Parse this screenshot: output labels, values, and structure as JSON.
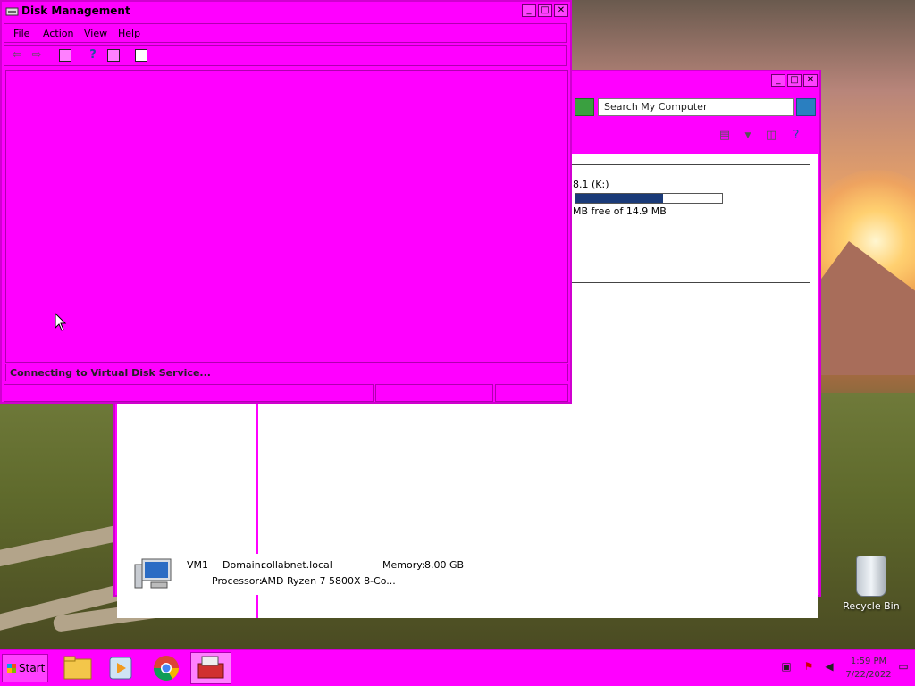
{
  "diskmgmt": {
    "title": "Disk Management",
    "menu": [
      "File",
      "Action",
      "View",
      "Help"
    ],
    "status_message": "Connecting to Virtual Disk Service..."
  },
  "explorer": {
    "search_placeholder": "Search My Computer",
    "drive_label": "8.1 (K:)",
    "drive_free_text": "MB free of 14.9 MB",
    "drive_used_fraction": 0.6,
    "computer_name": "VM1",
    "domain_label": "Domain:",
    "domain_value": "collabnet.local",
    "memory_label": "Memory:",
    "memory_value": "8.00 GB",
    "processor_label": "Processor:",
    "processor_value": "AMD Ryzen 7 5800X 8-Co..."
  },
  "desktop": {
    "recycle_bin_label": "Recycle Bin"
  },
  "taskbar": {
    "start_label": "Start",
    "apps": [
      "file-explorer",
      "media-player",
      "chrome",
      "toolbox"
    ],
    "clock_time": "1:59 PM",
    "clock_date": "7/22/2022"
  },
  "colors": {
    "window_bg": "#ff00ff",
    "drive_fill": "#1a3a78"
  }
}
